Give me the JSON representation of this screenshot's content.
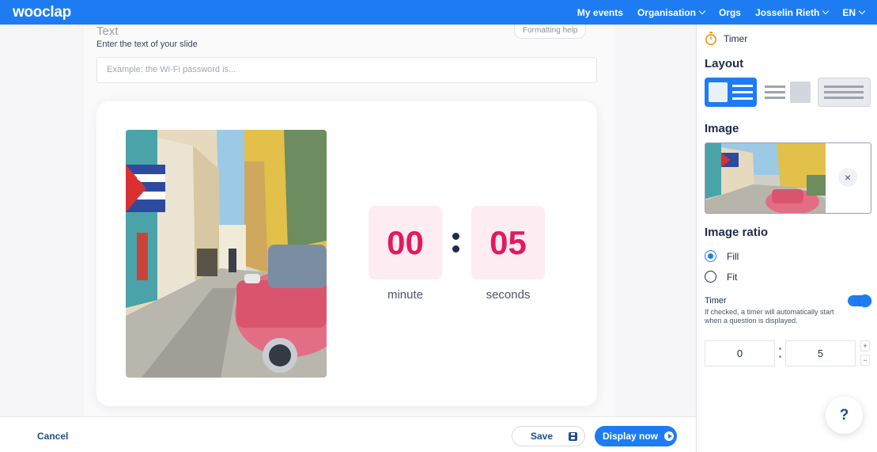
{
  "header": {
    "logo": "wooclap",
    "nav": [
      {
        "label": "My events",
        "dropdown": false
      },
      {
        "label": "Organisation",
        "dropdown": true
      },
      {
        "label": "Orgs",
        "dropdown": false
      },
      {
        "label": "Josselin Rieth",
        "dropdown": true
      },
      {
        "label": "EN",
        "dropdown": true
      }
    ]
  },
  "editor": {
    "text_heading": "Text",
    "text_subtitle": "Enter the text of your slide",
    "formatting_help": "Formatting help",
    "text_placeholder": "Example: the Wi-Fi password is...",
    "timer": {
      "minutes": "00",
      "seconds": "05",
      "minute_label": "minute",
      "seconds_label": "seconds"
    }
  },
  "footer": {
    "cancel_label": "Cancel",
    "save_label": "Save",
    "display_label": "Display now"
  },
  "panel": {
    "timer_title": "Timer",
    "layout_heading": "Layout",
    "selected_layout": 1,
    "image_heading": "Image",
    "remove_image": "×",
    "ratio_heading": "Image ratio",
    "ratio_options": [
      {
        "label": "Fill",
        "checked": true
      },
      {
        "label": "Fit",
        "checked": false
      }
    ],
    "timer_label": "Timer",
    "timer_enabled": true,
    "timer_description": "If checked, a timer will automatically start when a question is displayed.",
    "timer_minutes_value": "0",
    "timer_seconds_value": "5",
    "stepper_up": "+",
    "stepper_down": "−",
    "help_label": "?"
  },
  "colors": {
    "brand_blue": "#1d7cf2",
    "timer_pink": "#e3195f",
    "timer_bg": "#fdecf1",
    "navy": "#1f2b4d"
  }
}
